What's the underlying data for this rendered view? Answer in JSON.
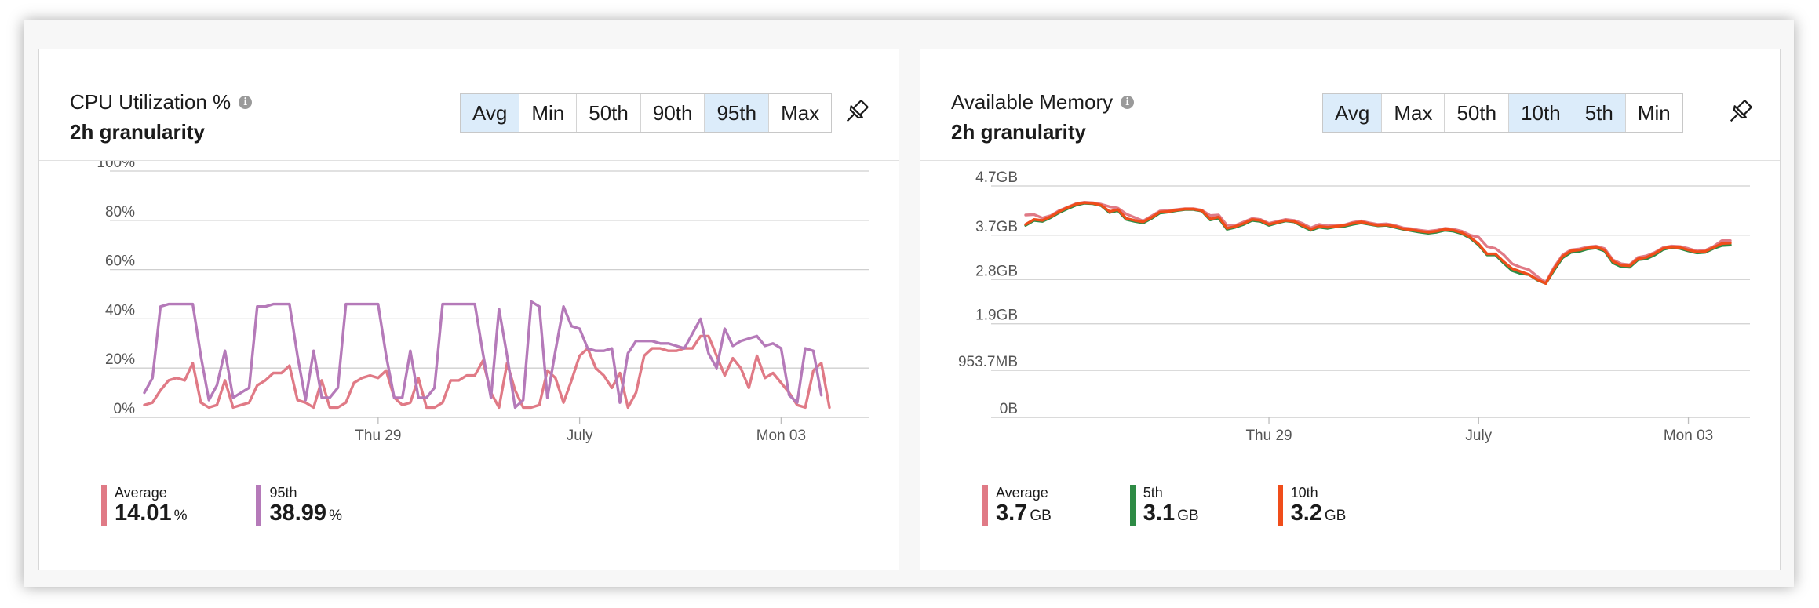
{
  "colors": {
    "average": "#e07a86",
    "p95": "#b57ab9",
    "p5": "#2e8b45",
    "p10": "#f04d1a",
    "selected_bg": "#dcecfa"
  },
  "cpu": {
    "title": "CPU Utilization %",
    "info_icon": "info-icon",
    "granularity": "2h granularity",
    "buttons": [
      {
        "label": "Avg",
        "selected": true
      },
      {
        "label": "Min",
        "selected": false
      },
      {
        "label": "50th",
        "selected": false
      },
      {
        "label": "90th",
        "selected": false
      },
      {
        "label": "95th",
        "selected": true
      },
      {
        "label": "Max",
        "selected": false
      }
    ],
    "pin_icon": "pin-icon",
    "legend": [
      {
        "name": "Average",
        "value": "14.01",
        "unit": "%",
        "color": "#e07a86"
      },
      {
        "name": "95th",
        "value": "38.99",
        "unit": "%",
        "color": "#b57ab9"
      }
    ]
  },
  "memory": {
    "title": "Available Memory",
    "info_icon": "info-icon",
    "granularity": "2h granularity",
    "buttons": [
      {
        "label": "Avg",
        "selected": true
      },
      {
        "label": "Max",
        "selected": false
      },
      {
        "label": "50th",
        "selected": false
      },
      {
        "label": "10th",
        "selected": true
      },
      {
        "label": "5th",
        "selected": true
      },
      {
        "label": "Min",
        "selected": false
      }
    ],
    "pin_icon": "pin-icon",
    "legend": [
      {
        "name": "Average",
        "value": "3.7",
        "unit": "GB",
        "color": "#e07a86"
      },
      {
        "name": "5th",
        "value": "3.1",
        "unit": "GB",
        "color": "#2e8b45"
      },
      {
        "name": "10th",
        "value": "3.2",
        "unit": "GB",
        "color": "#f04d1a"
      }
    ]
  },
  "chart_data": [
    {
      "type": "line",
      "title": "CPU Utilization %",
      "y_ticks": [
        "0%",
        "20%",
        "40%",
        "60%",
        "80%",
        "100%"
      ],
      "ylim": [
        0,
        100
      ],
      "x_tick_labels": [
        "Thu 29",
        "July",
        "Mon 03"
      ],
      "x_tick_index": [
        29,
        54,
        79
      ],
      "grid": true,
      "legend_position": "bottom-left",
      "series": [
        {
          "name": "Average",
          "color": "#e07a86",
          "values": [
            5,
            6,
            11,
            15,
            16,
            15,
            22,
            6,
            4,
            5,
            15,
            4,
            5,
            6,
            13,
            15,
            18,
            18,
            21,
            7,
            6,
            4,
            15,
            4,
            4,
            6,
            14,
            16,
            17,
            16,
            19,
            8,
            5,
            6,
            16,
            4,
            4,
            6,
            15,
            15,
            17,
            17,
            23,
            10,
            4,
            22,
            11,
            4,
            4,
            5,
            19,
            16,
            6,
            15,
            25,
            28,
            20,
            17,
            12,
            18,
            4,
            10,
            25,
            28,
            28,
            27,
            27,
            28,
            28,
            33,
            33,
            25,
            17,
            24,
            20,
            12,
            25,
            16,
            18,
            14,
            10,
            5,
            4,
            19,
            22,
            4
          ]
        },
        {
          "name": "95th",
          "color": "#b57ab9",
          "values": [
            10,
            16,
            45,
            46,
            46,
            46,
            46,
            25,
            7,
            13,
            27,
            8,
            10,
            12,
            45,
            45,
            46,
            46,
            46,
            25,
            7,
            27,
            8,
            8,
            12,
            46,
            46,
            46,
            46,
            46,
            25,
            8,
            8,
            27,
            8,
            8,
            12,
            46,
            46,
            46,
            46,
            46,
            26,
            8,
            44,
            25,
            4,
            7,
            47,
            45,
            8,
            27,
            45,
            37,
            36,
            28,
            27,
            27,
            28,
            6,
            26,
            31,
            31,
            31,
            30,
            30,
            29,
            28,
            34,
            40,
            26,
            20,
            36,
            29,
            31,
            32,
            33,
            29,
            30,
            28,
            9,
            6,
            28,
            27,
            9
          ]
        }
      ]
    },
    {
      "type": "line",
      "title": "Available Memory",
      "y_ticks": [
        "0B",
        "953.7MB",
        "1.9GB",
        "2.8GB",
        "3.7GB",
        "4.7GB"
      ],
      "ylim": [
        0,
        4.7
      ],
      "y_tick_values": [
        0,
        0.9537,
        1.9,
        2.8,
        3.7,
        4.7
      ],
      "y_unit": "GB",
      "x_tick_labels": [
        "Thu 29",
        "July",
        "Mon 03"
      ],
      "x_tick_index": [
        29,
        54,
        79
      ],
      "grid": true,
      "legend_position": "bottom-left",
      "series": [
        {
          "name": "Average",
          "color": "#e07a86",
          "values": [
            4.11,
            4.12,
            4.05,
            4.1,
            4.2,
            4.27,
            4.34,
            4.37,
            4.36,
            4.33,
            4.28,
            4.25,
            4.13,
            4.06,
            3.99,
            4.09,
            4.19,
            4.2,
            4.22,
            4.24,
            4.24,
            4.21,
            4.1,
            4.11,
            3.9,
            3.9,
            3.97,
            4.04,
            4.02,
            3.94,
            3.98,
            4.02,
            4.0,
            3.94,
            3.85,
            3.92,
            3.89,
            3.9,
            3.91,
            3.96,
            3.99,
            3.95,
            3.92,
            3.93,
            3.9,
            3.85,
            3.83,
            3.8,
            3.78,
            3.8,
            3.84,
            3.82,
            3.78,
            3.7,
            3.66,
            3.47,
            3.43,
            3.3,
            3.12,
            3.05,
            3.0,
            2.86,
            2.74,
            3.05,
            3.3,
            3.4,
            3.42,
            3.46,
            3.48,
            3.43,
            3.2,
            3.12,
            3.1,
            3.25,
            3.28,
            3.35,
            3.45,
            3.48,
            3.47,
            3.43,
            3.38,
            3.39,
            3.47,
            3.59,
            3.59
          ]
        },
        {
          "name": "5th",
          "color": "#2e8b45",
          "values": [
            3.9,
            4.0,
            3.98,
            4.06,
            4.16,
            4.24,
            4.31,
            4.35,
            4.34,
            4.3,
            4.16,
            4.2,
            4.02,
            3.98,
            3.95,
            4.04,
            4.15,
            4.17,
            4.2,
            4.22,
            4.22,
            4.19,
            4.01,
            4.05,
            3.82,
            3.86,
            3.92,
            4.0,
            3.98,
            3.9,
            3.95,
            3.99,
            3.97,
            3.88,
            3.8,
            3.86,
            3.84,
            3.87,
            3.88,
            3.92,
            3.95,
            3.92,
            3.89,
            3.9,
            3.86,
            3.82,
            3.79,
            3.76,
            3.74,
            3.76,
            3.8,
            3.78,
            3.73,
            3.64,
            3.5,
            3.3,
            3.3,
            3.13,
            2.98,
            2.92,
            2.9,
            2.79,
            2.72,
            2.99,
            3.24,
            3.35,
            3.37,
            3.42,
            3.44,
            3.38,
            3.14,
            3.06,
            3.05,
            3.2,
            3.22,
            3.3,
            3.41,
            3.45,
            3.43,
            3.38,
            3.34,
            3.35,
            3.43,
            3.49,
            3.5
          ]
        },
        {
          "name": "10th",
          "color": "#f04d1a",
          "values": [
            3.92,
            4.02,
            4.0,
            4.08,
            4.18,
            4.26,
            4.33,
            4.36,
            4.35,
            4.31,
            4.18,
            4.22,
            4.04,
            4.0,
            3.97,
            4.06,
            4.17,
            4.18,
            4.21,
            4.23,
            4.23,
            4.2,
            4.03,
            4.07,
            3.84,
            3.88,
            3.94,
            4.02,
            4.0,
            3.92,
            3.96,
            4.0,
            3.98,
            3.9,
            3.82,
            3.88,
            3.86,
            3.88,
            3.9,
            3.94,
            3.97,
            3.93,
            3.9,
            3.91,
            3.88,
            3.83,
            3.81,
            3.78,
            3.76,
            3.78,
            3.82,
            3.8,
            3.75,
            3.66,
            3.52,
            3.32,
            3.32,
            3.16,
            3.02,
            2.96,
            2.9,
            2.8,
            2.72,
            3.02,
            3.27,
            3.38,
            3.4,
            3.44,
            3.46,
            3.4,
            3.17,
            3.09,
            3.08,
            3.22,
            3.25,
            3.33,
            3.43,
            3.46,
            3.45,
            3.4,
            3.36,
            3.37,
            3.45,
            3.53,
            3.54
          ]
        }
      ]
    }
  ]
}
